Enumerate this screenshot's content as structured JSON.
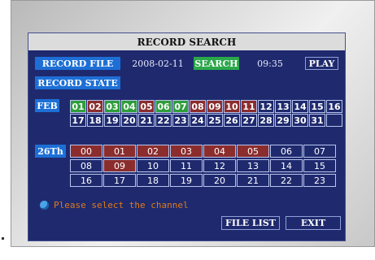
{
  "dialog": {
    "title": "RECORD SEARCH"
  },
  "controls": {
    "record_file_label": "RECORD FILE",
    "date_value": "2008-02-11",
    "search_label": "SEARCH",
    "time_value": "09:35",
    "play_label": "PLAY",
    "record_state_label": "RECORD STATE"
  },
  "calendar": {
    "month_label": "FEB",
    "days": [
      {
        "label": "01",
        "state": "green"
      },
      {
        "label": "02",
        "state": "red"
      },
      {
        "label": "03",
        "state": "green"
      },
      {
        "label": "04",
        "state": "green"
      },
      {
        "label": "05",
        "state": "red"
      },
      {
        "label": "06",
        "state": "green"
      },
      {
        "label": "07",
        "state": "green"
      },
      {
        "label": "08",
        "state": "red"
      },
      {
        "label": "09",
        "state": "red"
      },
      {
        "label": "10",
        "state": "red"
      },
      {
        "label": "11",
        "state": "red"
      },
      {
        "label": "12",
        "state": "none"
      },
      {
        "label": "13",
        "state": "none"
      },
      {
        "label": "14",
        "state": "none"
      },
      {
        "label": "15",
        "state": "none"
      },
      {
        "label": "16",
        "state": "none"
      },
      {
        "label": "17",
        "state": "none"
      },
      {
        "label": "18",
        "state": "none"
      },
      {
        "label": "19",
        "state": "none"
      },
      {
        "label": "20",
        "state": "none"
      },
      {
        "label": "21",
        "state": "none"
      },
      {
        "label": "22",
        "state": "none"
      },
      {
        "label": "23",
        "state": "none"
      },
      {
        "label": "24",
        "state": "none"
      },
      {
        "label": "25",
        "state": "none"
      },
      {
        "label": "26",
        "state": "none"
      },
      {
        "label": "27",
        "state": "none"
      },
      {
        "label": "28",
        "state": "none"
      },
      {
        "label": "29",
        "state": "none"
      },
      {
        "label": "30",
        "state": "none"
      },
      {
        "label": "31",
        "state": "none"
      },
      {
        "label": "",
        "state": "empty"
      }
    ]
  },
  "hours": {
    "day_label": "26Th",
    "cells": [
      {
        "label": "00",
        "state": "red"
      },
      {
        "label": "01",
        "state": "red"
      },
      {
        "label": "02",
        "state": "red"
      },
      {
        "label": "03",
        "state": "red"
      },
      {
        "label": "04",
        "state": "red"
      },
      {
        "label": "05",
        "state": "red"
      },
      {
        "label": "06",
        "state": "none"
      },
      {
        "label": "07",
        "state": "none"
      },
      {
        "label": "08",
        "state": "none"
      },
      {
        "label": "09",
        "state": "red"
      },
      {
        "label": "10",
        "state": "none"
      },
      {
        "label": "11",
        "state": "none"
      },
      {
        "label": "12",
        "state": "none"
      },
      {
        "label": "13",
        "state": "none"
      },
      {
        "label": "14",
        "state": "none"
      },
      {
        "label": "15",
        "state": "none"
      },
      {
        "label": "16",
        "state": "none"
      },
      {
        "label": "17",
        "state": "none"
      },
      {
        "label": "18",
        "state": "none"
      },
      {
        "label": "19",
        "state": "none"
      },
      {
        "label": "20",
        "state": "none"
      },
      {
        "label": "21",
        "state": "none"
      },
      {
        "label": "22",
        "state": "none"
      },
      {
        "label": "23",
        "state": "none"
      }
    ]
  },
  "hint": {
    "icon": "info-bubble-icon",
    "text": "Please select the channel"
  },
  "footer": {
    "file_list_label": "FILE LIST",
    "exit_label": "EXIT"
  },
  "colors": {
    "screen_bg": "#1f2a6e",
    "green": "#2e9e3a",
    "red": "#8b2d2d",
    "button_blue": "#1d6fd6",
    "hint_orange": "#e07a1a"
  }
}
